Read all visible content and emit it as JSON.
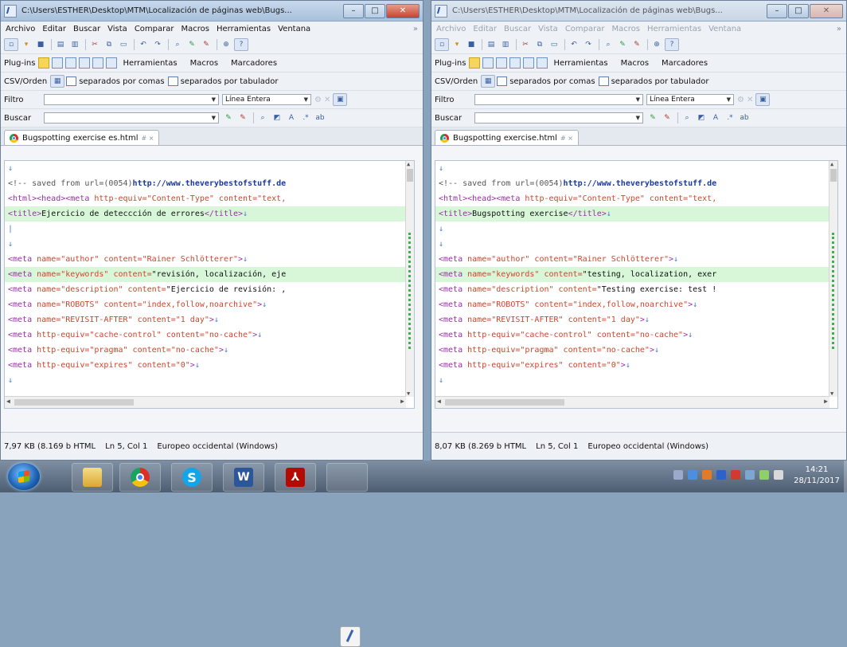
{
  "left_window": {
    "title": "C:\\Users\\ESTHER\\Desktop\\MTM\\Localización de páginas web\\Bugs...",
    "menu": [
      "Archivo",
      "Editar",
      "Buscar",
      "Vista",
      "Comparar",
      "Macros",
      "Herramientas",
      "Ventana"
    ],
    "plugins_label": "Plug-ins",
    "herramientas_btn": "Herramientas",
    "macros_btn": "Macros",
    "marcadores_btn": "Marcadores",
    "csv_label": "CSV/Orden",
    "csv_comas": "separados por comas",
    "csv_tab": "separados por tabulador",
    "filtro_label": "Filtro",
    "filtro_mode": "Línea Entera",
    "buscar_label": "Buscar",
    "tab_label": "Bugspotting exercise es.html",
    "tab_suffix": "# ×",
    "code": [
      {
        "plain": "↓"
      },
      {
        "cmt": "<!-- saved from url=(0054)",
        "url": "http://www.theverybestofstuff.de"
      },
      {
        "tag": "<html><head><meta",
        "attr": " http-equiv=",
        "str": "\"Content-Type\"",
        "attr2": " content=",
        "str2": "\"text,"
      },
      {
        "hl": true,
        "tag": "<title>",
        "text": "Ejercicio de deteccción de errores",
        "tag2": "</title>",
        "eol": "↓"
      },
      {
        "plain": "|"
      },
      {
        "plain": "↓"
      },
      {
        "tag": "<meta",
        "attr": " name=",
        "str": "\"author\"",
        "attr2": " content=",
        "str2": "\"Rainer Schlötterer\"",
        "tag2": ">",
        "eol": "↓"
      },
      {
        "hl": true,
        "tag": "<meta",
        "attr": " name=",
        "str": "\"keywords\"",
        "attr2": " content=",
        "text": "\"revisión, localización, eje"
      },
      {
        "tag": "<meta",
        "attr": " name=",
        "str": "\"description\"",
        "attr2": " content=",
        "text": "\"Ejercicio de revisión: ,"
      },
      {
        "tag": "<meta",
        "attr": " name=",
        "str": "\"ROBOTS\"",
        "attr2": " content=",
        "str2": "\"index,follow,noarchive\"",
        "tag2": ">",
        "eol": "↓"
      },
      {
        "tag": "<meta",
        "attr": " name=",
        "str": "\"REVISIT-AFTER\"",
        "attr2": " content=",
        "str2": "\"1 day\"",
        "tag2": ">",
        "eol": "↓"
      },
      {
        "tag": "<meta",
        "attr": " http-equiv=",
        "str": "\"cache-control\"",
        "attr2": " content=",
        "str2": "\"no-cache\"",
        "tag2": ">",
        "eol": "↓"
      },
      {
        "tag": "<meta",
        "attr": " http-equiv=",
        "str": "\"pragma\"",
        "attr2": " content=",
        "str2": "\"no-cache\"",
        "tag2": ">",
        "eol": "↓"
      },
      {
        "tag": "<meta",
        "attr": " http-equiv=",
        "str": "\"expires\"",
        "attr2": " content=",
        "str2": "\"0\"",
        "tag2": ">",
        "eol": "↓"
      },
      {
        "plain": "↓"
      }
    ],
    "status": {
      "size": "7,97 KB (8.169 b",
      "type": "HTML",
      "pos": "Ln 5, Col 1",
      "encoding": "Europeo occidental (Windows)"
    }
  },
  "right_window": {
    "title": "C:\\Users\\ESTHER\\Desktop\\MTM\\Localización de páginas web\\Bugs...",
    "menu": [
      "Archivo",
      "Editar",
      "Buscar",
      "Vista",
      "Comparar",
      "Macros",
      "Herramientas",
      "Ventana"
    ],
    "plugins_label": "Plug-ins",
    "herramientas_btn": "Herramientas",
    "macros_btn": "Macros",
    "marcadores_btn": "Marcadores",
    "csv_label": "CSV/Orden",
    "csv_comas": "separados por comas",
    "csv_tab": "separados por tabulador",
    "filtro_label": "Filtro",
    "filtro_mode": "Línea Entera",
    "buscar_label": "Buscar",
    "tab_label": "Bugspotting exercise.html",
    "tab_suffix": "# ×",
    "code": [
      {
        "plain": "↓"
      },
      {
        "cmt": "<!-- saved from url=(0054)",
        "url": "http://www.theverybestofstuff.de"
      },
      {
        "tag": "<html><head><meta",
        "attr": " http-equiv=",
        "str": "\"Content-Type\"",
        "attr2": " content=",
        "str2": "\"text,"
      },
      {
        "hl": true,
        "tag": "<title>",
        "text": "Bugspotting exercise",
        "tag2": "</title>",
        "eol": "↓"
      },
      {
        "plain": "↓"
      },
      {
        "plain": "↓"
      },
      {
        "tag": "<meta",
        "attr": " name=",
        "str": "\"author\"",
        "attr2": " content=",
        "str2": "\"Rainer Schlötterer\"",
        "tag2": ">",
        "eol": "↓"
      },
      {
        "hl": true,
        "tag": "<meta",
        "attr": " name=",
        "str": "\"keywords\"",
        "attr2": " content=",
        "text": "\"testing, localization, exer"
      },
      {
        "tag": "<meta",
        "attr": " name=",
        "str": "\"description\"",
        "attr2": " content=",
        "text": "\"Testing exercise: test !"
      },
      {
        "tag": "<meta",
        "attr": " name=",
        "str": "\"ROBOTS\"",
        "attr2": " content=",
        "str2": "\"index,follow,noarchive\"",
        "tag2": ">",
        "eol": "↓"
      },
      {
        "tag": "<meta",
        "attr": " name=",
        "str": "\"REVISIT-AFTER\"",
        "attr2": " content=",
        "str2": "\"1 day\"",
        "tag2": ">",
        "eol": "↓"
      },
      {
        "tag": "<meta",
        "attr": " http-equiv=",
        "str": "\"cache-control\"",
        "attr2": " content=",
        "str2": "\"no-cache\"",
        "tag2": ">",
        "eol": "↓"
      },
      {
        "tag": "<meta",
        "attr": " http-equiv=",
        "str": "\"pragma\"",
        "attr2": " content=",
        "str2": "\"no-cache\"",
        "tag2": ">",
        "eol": "↓"
      },
      {
        "tag": "<meta",
        "attr": " http-equiv=",
        "str": "\"expires\"",
        "attr2": " content=",
        "str2": "\"0\"",
        "tag2": ">",
        "eol": "↓"
      },
      {
        "plain": "↓"
      }
    ],
    "status": {
      "size": "8,07 KB (8.269 b",
      "type": "HTML",
      "pos": "Ln 5, Col 1",
      "encoding": "Europeo occidental (Windows)"
    }
  },
  "taskbar": {
    "apps": [
      "explorer-icon",
      "chrome-icon",
      "skype-icon",
      "word-icon",
      "acrobat-icon",
      "editor-icon"
    ],
    "time": "14:21",
    "date": "28/11/2017"
  },
  "colors": {
    "diff_highlight": "#d8f7d8",
    "tag": "#9a2ea8",
    "string": "#d0452c",
    "url": "#1b3a9c"
  }
}
